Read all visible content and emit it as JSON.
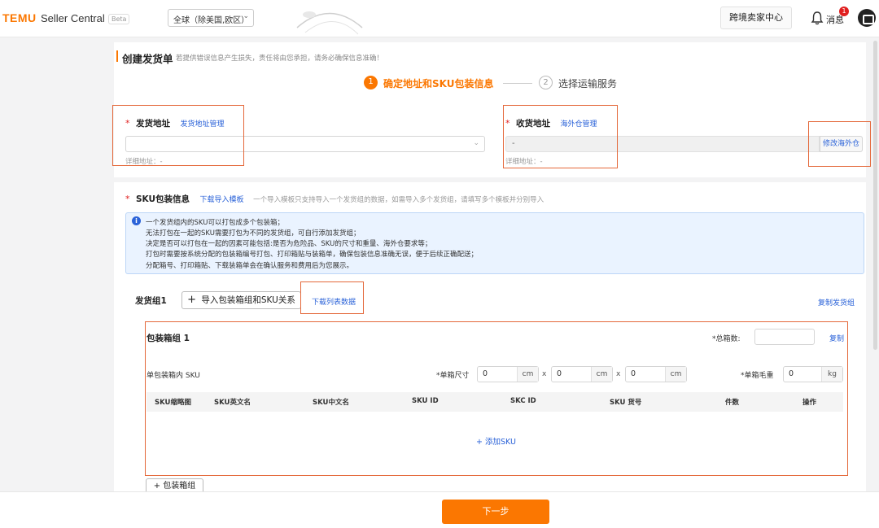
{
  "app": {
    "logo": "TEMU",
    "name": "Seller Central",
    "beta": "Beta",
    "region": "全球（除美国,欧区）",
    "seller_center": "跨境卖家中心",
    "messages": "消息",
    "message_count": "1"
  },
  "page": {
    "title": "创建发货单",
    "hint": "若提供错误信息产生损失，责任将由您承担，请务必确保信息准确！"
  },
  "steps": [
    {
      "num": "1",
      "label": "确定地址和SKU包装信息"
    },
    {
      "num": "2",
      "label": "选择运输服务"
    }
  ],
  "ship_from": {
    "required": "*",
    "label": "发货地址",
    "manage_link": "发货地址管理",
    "value": "",
    "detail_label": "详细地址：-"
  },
  "ship_to": {
    "required": "*",
    "label": "收货地址",
    "manage_link": "海外仓管理",
    "value": "-",
    "detail_label": "详细地址：-",
    "modify_button": "修改海外仓"
  },
  "sku_pack": {
    "required": "*",
    "label": "SKU包装信息",
    "template_link": "下载导入模板",
    "hint": "一个导入模板只支持导入一个发货组的数据，如需导入多个发货组，请填写多个模板并分别导入"
  },
  "info_lines": [
    "一个发货组内的SKU可以打包成多个包装箱；",
    "无法打包在一起的SKU需要打包为不同的发货组，可自行添加发货组；",
    "决定是否可以打包在一起的因素可能包括:是否为危险品、SKU的尺寸和重量、海外仓要求等；",
    "打包时需要按系统分配的包装箱编号打包、打印箱贴与装箱单，确保包装信息准确无误，便于后续正确配送；",
    "分配箱号、打印箱贴、下载装箱单会在确认服务和费用后为您展示。"
  ],
  "group": {
    "label": "发货组1",
    "import_button": "导入包装箱组和SKU关系",
    "download_link": "下载列表数据",
    "copy_group_link": "复制发货组"
  },
  "box": {
    "title": "包装箱组 1",
    "total_label": "*总箱数:",
    "total_value": "",
    "copy_link": "复制",
    "sku_in_box": "单包装箱内 SKU",
    "size_label": "*单箱尺寸",
    "dims": [
      {
        "value": "0",
        "unit": "cm"
      },
      {
        "value": "0",
        "unit": "cm"
      },
      {
        "value": "0",
        "unit": "cm"
      }
    ],
    "x": "x",
    "weight_label": "*单箱毛重",
    "weight": {
      "value": "0",
      "unit": "kg"
    }
  },
  "table": {
    "columns": [
      "SKU缩略图",
      "SKU英文名",
      "SKU中文名",
      "SKU ID",
      "SKC ID",
      "SKU 货号",
      "件数",
      "操作"
    ],
    "add_sku": "+ 添加SKU"
  },
  "add_box_button": "+ 包装箱组",
  "next_button": "下一步",
  "colors": {
    "accent": "#fb7701",
    "link": "#2a62d8",
    "highlight": "#e4683a"
  },
  "icons": [
    "chevron-down-icon",
    "bell-icon",
    "plus-icon",
    "info-icon",
    "avatar-icon"
  ]
}
